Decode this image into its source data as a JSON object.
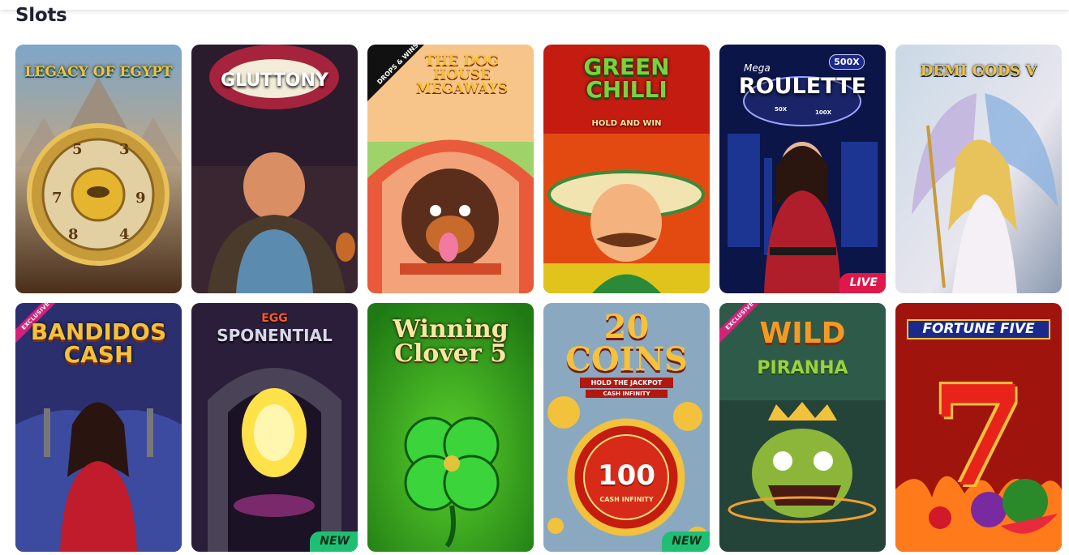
{
  "section": {
    "title": "Slots"
  },
  "games": [
    {
      "title": "LEGACY OF EGYPT"
    },
    {
      "title": "GLUTTONY"
    },
    {
      "title": "THE DOG HOUSE MEGAWAYS",
      "tag": "DROPS & WINS"
    },
    {
      "title": "GREEN CHILLI",
      "subtitle": "HOLD AND WIN"
    },
    {
      "title": "ROULETTE",
      "pre_title": "Mega",
      "multiplier": "500x",
      "wheel_values": [
        "50x",
        "100x"
      ],
      "badge": "LIVE"
    },
    {
      "title": "DEMI GODS V"
    },
    {
      "title": "BANDIDOS CASH",
      "ribbon": "EXCLUSIVE"
    },
    {
      "title": "EGG SPONENTIAL",
      "title_small": "EGG",
      "title_main": "SPONENTIAL",
      "badge": "NEW"
    },
    {
      "title": "Winning Clover 5"
    },
    {
      "title": "20 COINS",
      "subtitle": "HOLD THE JACKPOT",
      "subtitle2": "CASH INFINITY",
      "coin_value": "100",
      "coin_caption": "CASH INFINITY",
      "badge": "NEW"
    },
    {
      "title": "WILD PIRANHA",
      "title_top": "WILD",
      "title_bottom": "PIRANHA",
      "ribbon": "EXCLUSIVE"
    },
    {
      "title": "FORTUNE FIVE",
      "big_number": "7"
    }
  ],
  "colors": {
    "heading": "#1b2133",
    "live_badge": "#e0174a",
    "new_badge": "#1fbf73",
    "exclusive_ribbon": "#d6207b"
  }
}
